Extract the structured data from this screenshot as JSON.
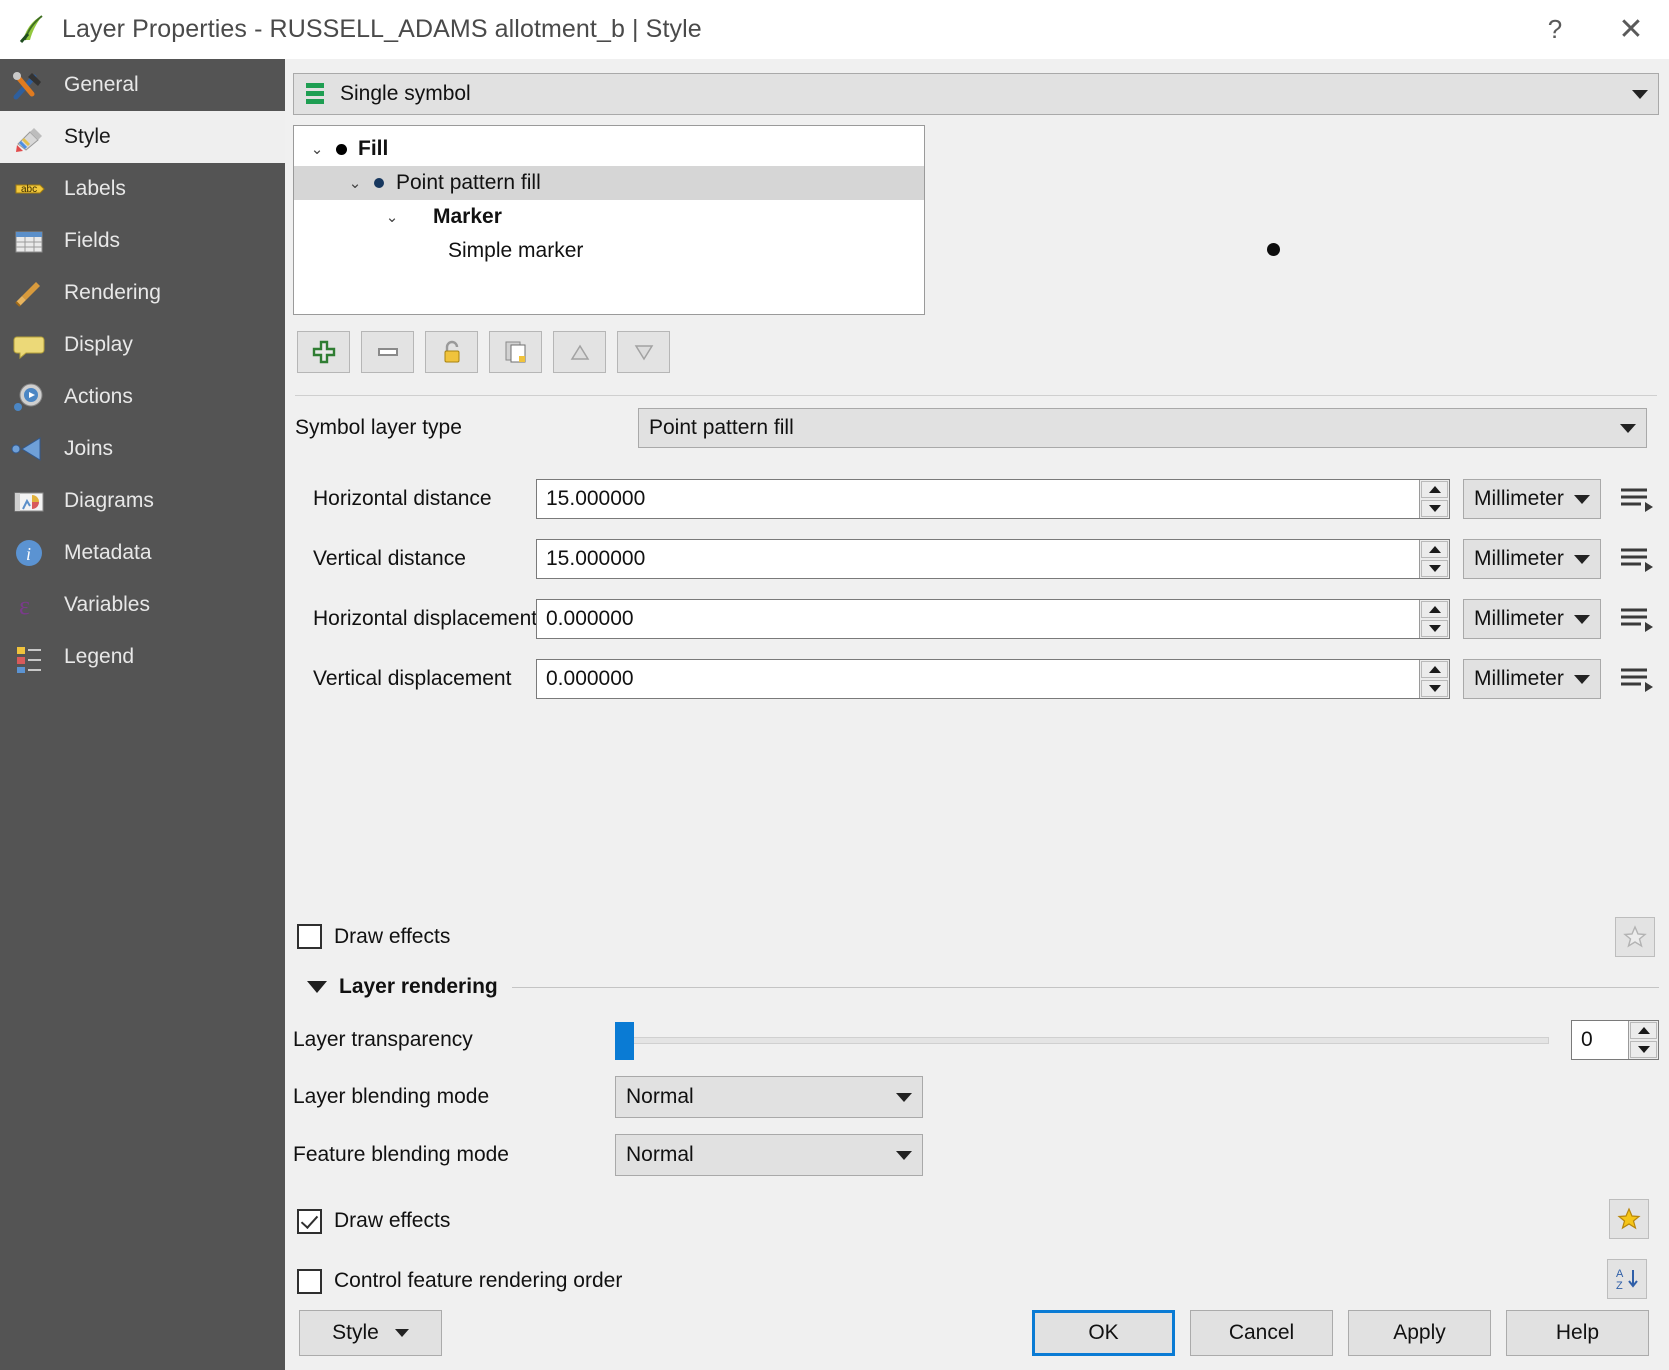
{
  "titlebar": {
    "title": "Layer Properties - RUSSELL_ADAMS allotment_b | Style",
    "help_label": "?",
    "close_label": "✕",
    "app_icon": "qgis-icon"
  },
  "sidebar": {
    "items": [
      {
        "label": "General",
        "icon": "hammer-wrench-icon",
        "active": false
      },
      {
        "label": "Style",
        "icon": "paintbrush-icon",
        "active": true
      },
      {
        "label": "Labels",
        "icon": "abc-tag-icon",
        "active": false
      },
      {
        "label": "Fields",
        "icon": "table-icon",
        "active": false
      },
      {
        "label": "Rendering",
        "icon": "broom-icon",
        "active": false
      },
      {
        "label": "Display",
        "icon": "speech-bubble-icon",
        "active": false
      },
      {
        "label": "Actions",
        "icon": "gear-play-icon",
        "active": false
      },
      {
        "label": "Joins",
        "icon": "arrow-left-icon",
        "active": false
      },
      {
        "label": "Diagrams",
        "icon": "chart-image-icon",
        "active": false
      },
      {
        "label": "Metadata",
        "icon": "info-circle-icon",
        "active": false
      },
      {
        "label": "Variables",
        "icon": "epsilon-icon",
        "active": false
      },
      {
        "label": "Legend",
        "icon": "legend-blocks-icon",
        "active": false
      }
    ]
  },
  "renderer": {
    "value": "Single symbol",
    "icon": "single-symbol-icon"
  },
  "symbol_tree": {
    "nodes": [
      {
        "label": "Fill",
        "indent": 0,
        "bold": true,
        "chevron": "⌄",
        "bullet": "black",
        "selected": false
      },
      {
        "label": "Point pattern fill",
        "indent": 1,
        "bold": false,
        "chevron": "⌄",
        "bullet": "blue",
        "selected": true
      },
      {
        "label": "Marker",
        "indent": 2,
        "bold": true,
        "chevron": "⌄",
        "bullet": "none",
        "selected": false
      },
      {
        "label": "Simple marker",
        "indent": 3,
        "bold": false,
        "chevron": "",
        "bullet": "none",
        "selected": false
      }
    ]
  },
  "symbol_toolbar": {
    "buttons": [
      {
        "name": "add-symbol-layer-button",
        "icon": "green-plus-icon",
        "enabled": true
      },
      {
        "name": "remove-symbol-layer-button",
        "icon": "minus-icon",
        "enabled": true
      },
      {
        "name": "lock-layer-colors-button",
        "icon": "padlock-icon",
        "enabled": true
      },
      {
        "name": "duplicate-symbol-layer-button",
        "icon": "duplicate-icon",
        "enabled": true
      },
      {
        "name": "move-layer-up-button",
        "icon": "triangle-up-icon",
        "enabled": false
      },
      {
        "name": "move-layer-down-button",
        "icon": "triangle-down-icon",
        "enabled": false
      }
    ]
  },
  "symbol_layer_type": {
    "label": "Symbol layer type",
    "value": "Point pattern fill"
  },
  "fields": [
    {
      "label": "Horizontal distance",
      "value": "15.000000",
      "unit": "Millimeter",
      "override_icon": "data-defined-override-icon"
    },
    {
      "label": "Vertical distance",
      "value": "15.000000",
      "unit": "Millimeter",
      "override_icon": "data-defined-override-icon"
    },
    {
      "label": "Horizontal displacement",
      "value": "0.000000",
      "unit": "Millimeter",
      "override_icon": "data-defined-override-icon"
    },
    {
      "label": "Vertical displacement",
      "value": "0.000000",
      "unit": "Millimeter",
      "override_icon": "data-defined-override-icon"
    }
  ],
  "symbol_draw_effects": {
    "label": "Draw effects",
    "checked": false,
    "effects_button_icon": "star-outline-icon"
  },
  "layer_rendering": {
    "title": "Layer rendering",
    "expanded": true,
    "transparency": {
      "label": "Layer transparency",
      "value": "0",
      "min": 0,
      "max": 100
    },
    "layer_blending": {
      "label": "Layer blending mode",
      "value": "Normal"
    },
    "feature_blending": {
      "label": "Feature blending mode",
      "value": "Normal"
    },
    "draw_effects": {
      "label": "Draw effects",
      "checked": true,
      "effects_button_icon": "star-filled-icon"
    },
    "render_order": {
      "label": "Control feature rendering order",
      "checked": false,
      "order_button_icon": "sort-az-icon"
    }
  },
  "footer": {
    "style_button": "Style",
    "ok": "OK",
    "cancel": "Cancel",
    "apply": "Apply",
    "help": "Help"
  },
  "colors": {
    "accent": "#0a7bd4",
    "sidebar_bg": "#545454",
    "panel_bg": "#f0f0f0",
    "selection": "#d6d6d6"
  }
}
